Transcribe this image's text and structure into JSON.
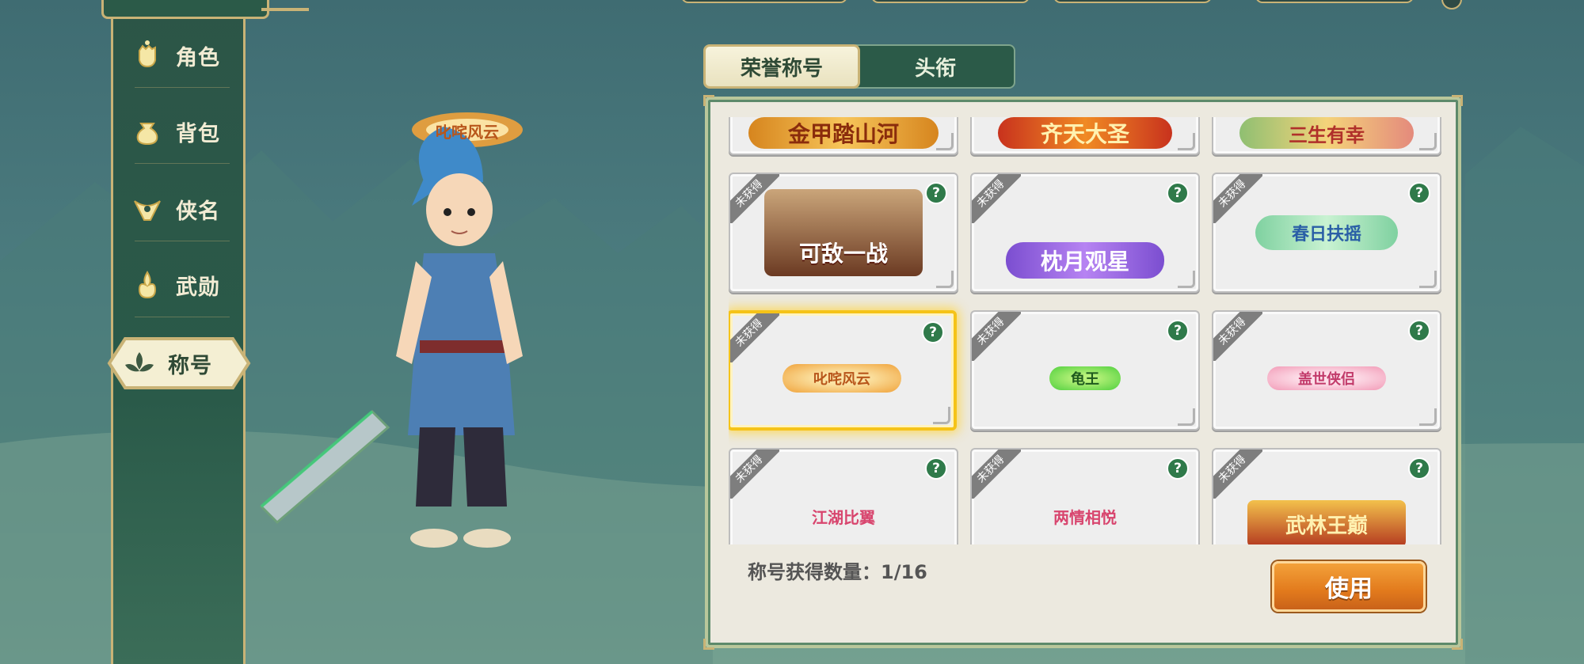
{
  "nav": {
    "items": [
      {
        "label": "角色",
        "icon": "fist-icon"
      },
      {
        "label": "背包",
        "icon": "bag-icon"
      },
      {
        "label": "侠名",
        "icon": "fan-icon"
      },
      {
        "label": "武勋",
        "icon": "flame-icon"
      },
      {
        "label": "称号",
        "icon": "lotus-icon",
        "active": true
      }
    ]
  },
  "character": {
    "equipped_title": "叱咤风云"
  },
  "tabs": [
    {
      "label": "荣誉称号",
      "active": true
    },
    {
      "label": "头衔",
      "active": false
    }
  ],
  "titles": {
    "unobtained_label": "未获得",
    "help_glyph": "?",
    "rows": [
      [
        {
          "name": "金甲踏山河",
          "obtained": true,
          "help": false
        },
        {
          "name": "齐天大圣",
          "obtained": true,
          "help": false
        },
        {
          "name": "三生有幸",
          "obtained": true,
          "help": false
        }
      ],
      [
        {
          "name": "可敌一战",
          "obtained": false,
          "help": true
        },
        {
          "name": "枕月观星",
          "obtained": false,
          "help": true
        },
        {
          "name": "春日扶摇",
          "obtained": false,
          "help": true
        }
      ],
      [
        {
          "name": "叱咤风云",
          "obtained": false,
          "help": true,
          "selected": true
        },
        {
          "name": "龟王",
          "obtained": false,
          "help": true
        },
        {
          "name": "盖世侠侣",
          "obtained": false,
          "help": true
        }
      ],
      [
        {
          "name": "江湖比翼",
          "obtained": false,
          "help": true
        },
        {
          "name": "两情相悦",
          "obtained": false,
          "help": true
        },
        {
          "name": "武林王巅",
          "obtained": false,
          "help": true
        }
      ]
    ]
  },
  "footer": {
    "count_text": "称号获得数量：1/16",
    "use_label": "使用"
  },
  "colors": {
    "accent_gold": "#c9b376",
    "panel_green": "#2b5a48",
    "use_button": "#e27a1c",
    "selected_border": "#f5c318"
  }
}
